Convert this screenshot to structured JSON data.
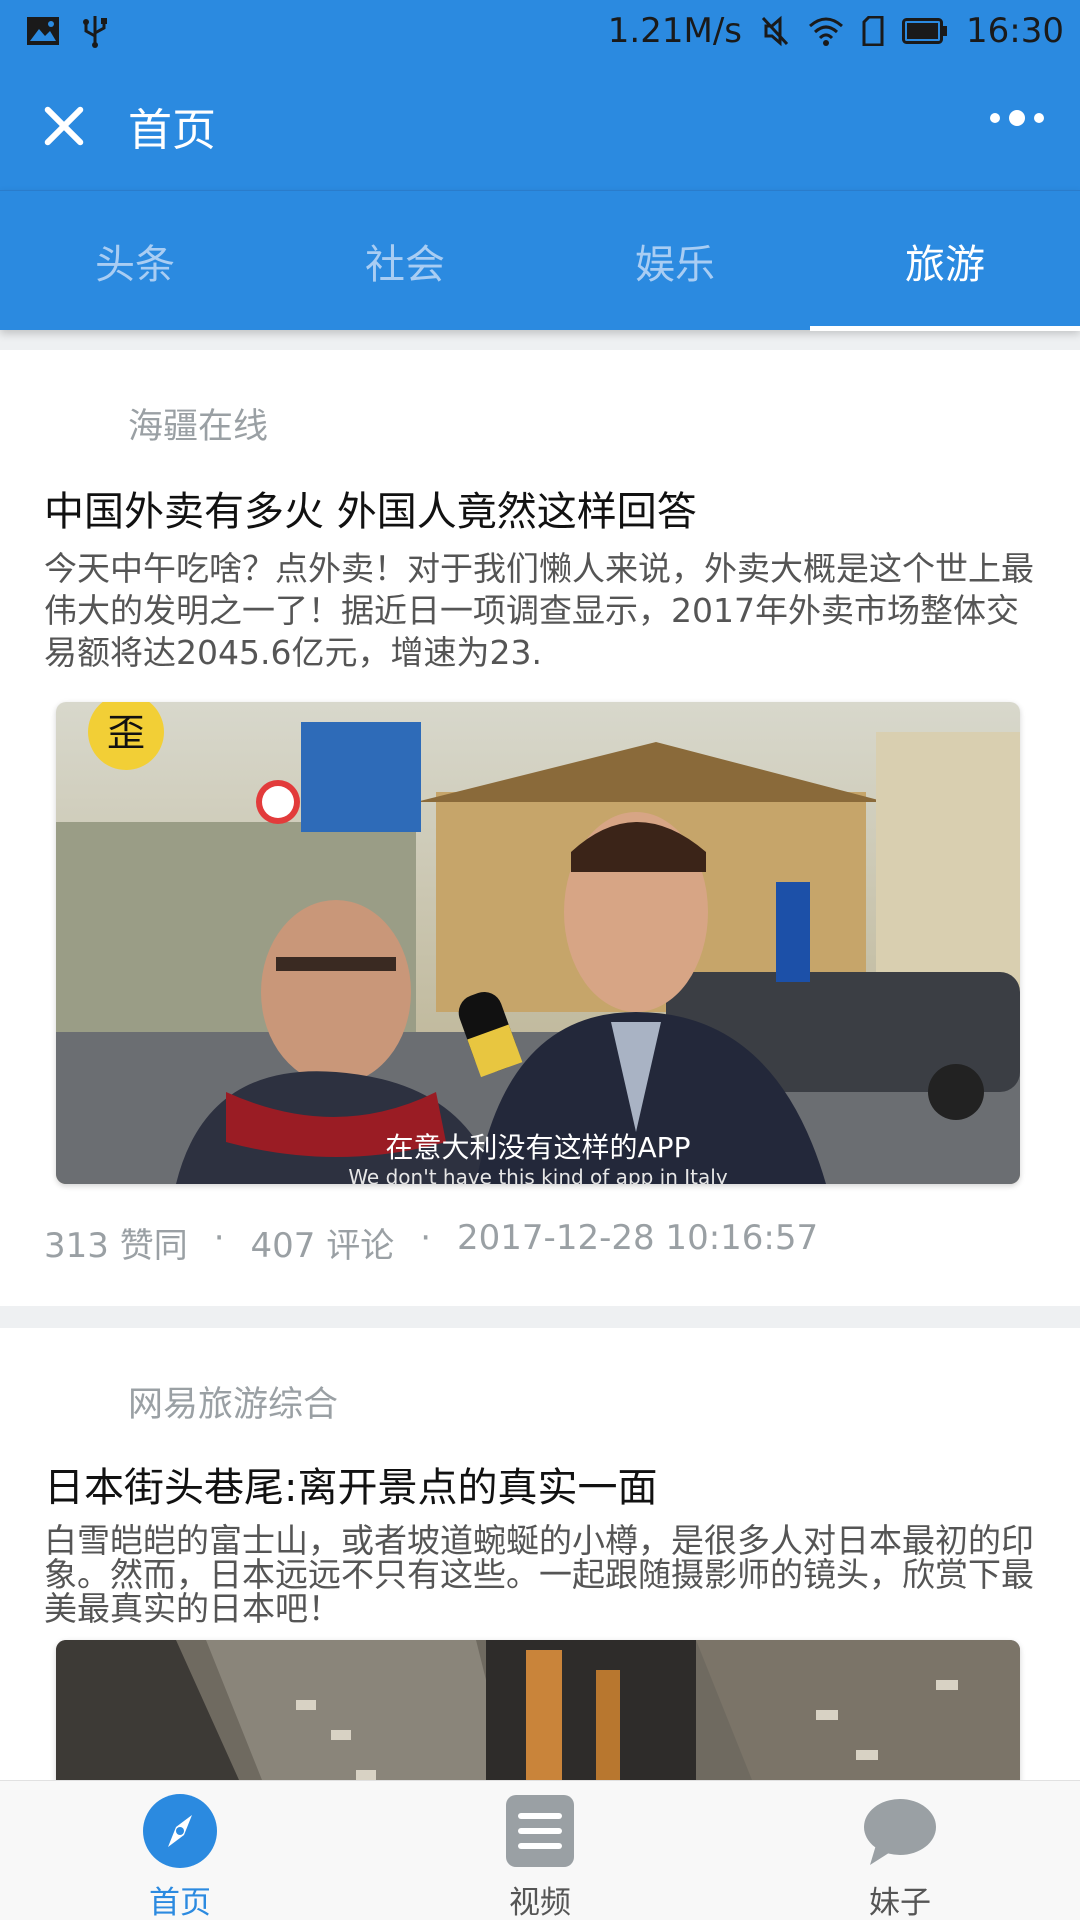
{
  "status_bar": {
    "speed": "1.21M/s",
    "time": "16:30"
  },
  "header": {
    "title": "首页"
  },
  "tabs": [
    {
      "label": "头条",
      "active": false
    },
    {
      "label": "社会",
      "active": false
    },
    {
      "label": "娱乐",
      "active": false
    },
    {
      "label": "旅游",
      "active": true
    }
  ],
  "articles": [
    {
      "source": "海疆在线",
      "title": "中国外卖有多火 外国人竟然这样回答",
      "summary": "今天中午吃啥？点外卖！对于我们懒人来说，外卖大概是这个世上最伟大的发明之一了！据近日一项调查显示，2017年外卖市场整体交易额将达2045.6亿元，增速为23.",
      "image_caption": "在意大利没有这样的APP",
      "image_caption_en": "We don't have this kind of app in Italy",
      "image_logo": "歪",
      "likes": "313 赞同",
      "comments": "407 评论",
      "time": "2017-12-28 10:16:57"
    },
    {
      "source": "网易旅游综合",
      "title": "日本街头巷尾:离开景点的真实一面",
      "summary": "白雪皑皑的富士山，或者坡道蜿蜒的小樽，是很多人对日本最初的印象。然而，日本远远不只有这些。一起跟随摄影师的镜头，欣赏下最美最真实的日本吧！"
    }
  ],
  "meta_sep": "·",
  "bottom_nav": [
    {
      "label": "首页",
      "active": true,
      "icon": "compass-icon"
    },
    {
      "label": "视频",
      "active": false,
      "icon": "list-icon"
    },
    {
      "label": "妹子",
      "active": false,
      "icon": "chat-bubble-icon"
    }
  ],
  "colors": {
    "primary": "#2b8ae0",
    "tab_inactive": "#a9cdf3",
    "meta_gray": "#9aa0a4"
  }
}
